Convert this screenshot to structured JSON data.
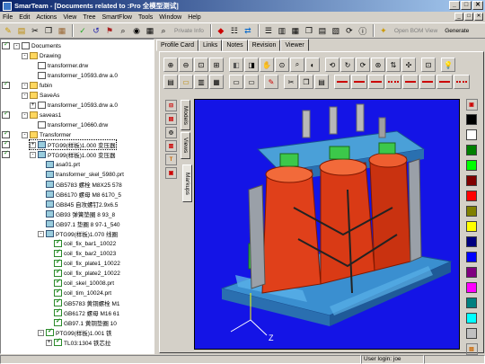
{
  "window": {
    "title": "SmarTeam - [Documents related to :Pro 全模型测试]",
    "buttons": [
      "_",
      "□",
      "✕"
    ]
  },
  "menu": [
    "File",
    "Edit",
    "Actions",
    "View",
    "Tree",
    "SmartFlow",
    "Tools",
    "Window",
    "Help"
  ],
  "toolbar": {
    "private_info": "Private Info",
    "open_bom": "Open BOM View",
    "generate": "Generate"
  },
  "tree": [
    {
      "label": "Documents",
      "depth": 1,
      "exp": "-",
      "type": "doc"
    },
    {
      "label": "Drawing",
      "depth": 2,
      "exp": "-",
      "type": "fold"
    },
    {
      "label": "transformer.drw",
      "depth": 3,
      "type": "doc"
    },
    {
      "label": "transformer_10593.drw a.0",
      "depth": 3,
      "type": "doc"
    },
    {
      "label": "fubin",
      "depth": 2,
      "exp": "-",
      "type": "fold"
    },
    {
      "label": "SaveAs",
      "depth": 2,
      "exp": "-",
      "type": "fold"
    },
    {
      "label": "transformer_10593.drw a.0",
      "depth": 3,
      "exp": "+",
      "type": "doc"
    },
    {
      "label": "saveas1",
      "depth": 2,
      "exp": "-",
      "type": "fold"
    },
    {
      "label": "transformer_10660.drw",
      "depth": 3,
      "type": "doc"
    },
    {
      "label": "Transformer",
      "depth": 2,
      "exp": "-",
      "type": "fold"
    },
    {
      "label": "PTG99(样板)1.000 变压器",
      "depth": 3,
      "exp": "+",
      "type": "part",
      "selected": true
    },
    {
      "label": "PTG99(样板)1.000 变压器",
      "depth": 3,
      "exp": "-",
      "type": "part"
    },
    {
      "label": "asa01.prt",
      "depth": 4,
      "type": "part"
    },
    {
      "label": "transformer_skel_5980.prt",
      "depth": 4,
      "type": "part"
    },
    {
      "label": "GB5783 螺栓 M8X25 578",
      "depth": 4,
      "type": "part"
    },
    {
      "label": "GB6170 螺母 M8 6170_5",
      "depth": 4,
      "type": "part"
    },
    {
      "label": "GB845 自攻螺钉2.9x6.5",
      "depth": 4,
      "type": "part"
    },
    {
      "label": "GB93 弹簧垫圈 8 93_8",
      "depth": 4,
      "type": "part"
    },
    {
      "label": "GB97.1 垫圈 8 97-1_540",
      "depth": 4,
      "type": "part"
    },
    {
      "label": "PTG99(样板)1.070 线圈",
      "depth": 4,
      "exp": "-",
      "type": "part"
    },
    {
      "label": "coil_fix_bar1_10022",
      "depth": 5,
      "type": "chk"
    },
    {
      "label": "coil_fix_bar2_10023",
      "depth": 5,
      "type": "chk"
    },
    {
      "label": "coil_fix_plate1_10022",
      "depth": 5,
      "type": "chk"
    },
    {
      "label": "coil_fix_plate2_10022",
      "depth": 5,
      "type": "chk"
    },
    {
      "label": "coil_skel_10008.prt",
      "depth": 5,
      "type": "chk"
    },
    {
      "label": "coil_tim_10024.prt",
      "depth": 5,
      "type": "chk"
    },
    {
      "label": "GB5783 黄铜螺栓 M1",
      "depth": 5,
      "type": "chk"
    },
    {
      "label": "GB6172 螺母 M16 61",
      "depth": 5,
      "type": "chk"
    },
    {
      "label": "GB97.1 黄铜垫圈 10",
      "depth": 5,
      "type": "chk"
    },
    {
      "label": "PTG99(样板)1.001 铁",
      "depth": 4,
      "exp": "-",
      "type": "chk"
    },
    {
      "label": "TL03:1304 铁芯拉",
      "depth": 5,
      "exp": "+",
      "type": "chk"
    }
  ],
  "tabs": [
    "Profile Card",
    "Links",
    "Notes",
    "Revision",
    "Viewer"
  ],
  "side_tabs": [
    "Models",
    "Views",
    "Markups"
  ],
  "viewport": {
    "axis_z": "Z"
  },
  "palette": {
    "colors": [
      "#000000",
      "#ffffff",
      "#008000",
      "#00ff00",
      "#800000",
      "#ff0000",
      "#808000",
      "#ffff00",
      "#000080",
      "#0000ff",
      "#800080",
      "#ff00ff",
      "#008080",
      "#00ffff",
      "#c0c0c0"
    ]
  },
  "status": {
    "user": "User login: joe"
  }
}
